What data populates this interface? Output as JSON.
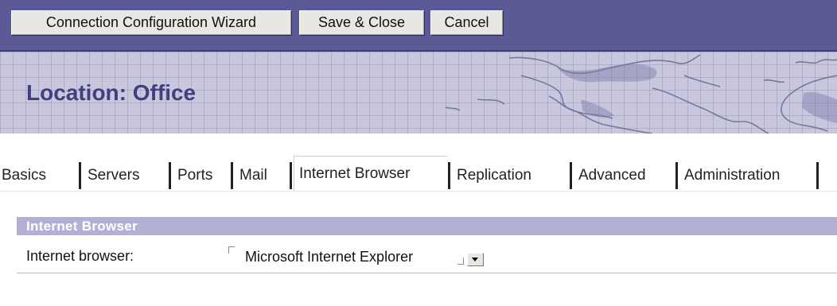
{
  "toolbar": {
    "buttons": [
      {
        "label": "Connection Configuration Wizard"
      },
      {
        "label": "Save & Close"
      },
      {
        "label": "Cancel"
      }
    ]
  },
  "banner": {
    "title": "Location: Office",
    "background_icon": "world-map-grid"
  },
  "tabs": {
    "items": [
      {
        "label": "Basics"
      },
      {
        "label": "Servers"
      },
      {
        "label": "Ports"
      },
      {
        "label": "Mail"
      },
      {
        "label": "Internet Browser"
      },
      {
        "label": "Replication"
      },
      {
        "label": "Advanced"
      },
      {
        "label": "Administration"
      }
    ],
    "active": "Internet Browser"
  },
  "section": {
    "header": "Internet Browser",
    "field_label": "Internet browser:",
    "field_value": "Microsoft Internet Explorer",
    "dropdown_icon": "chevron-down-icon"
  },
  "colors": {
    "toolbar_bg": "#5b5a97",
    "banner_title": "#403f80",
    "section_header_bg": "#b3b0d6"
  }
}
